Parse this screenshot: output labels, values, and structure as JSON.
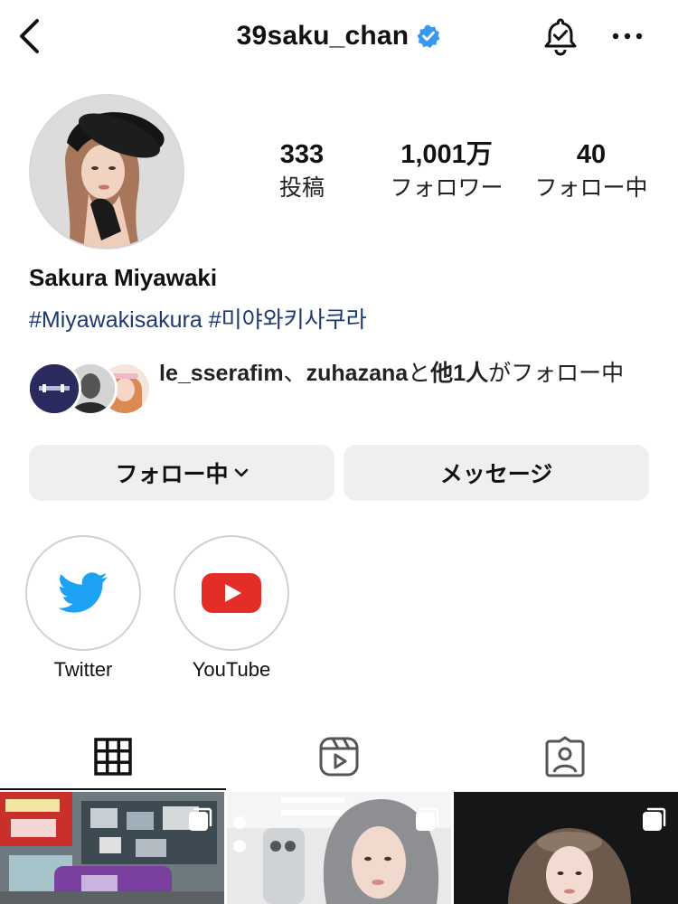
{
  "header": {
    "username": "39saku_chan",
    "back_icon": "chevron-left-icon",
    "verified_icon": "verified-badge-icon",
    "bell_icon": "bell-check-icon",
    "more_icon": "more-horizontal-icon"
  },
  "profile": {
    "display_name": "Sakura Miyawaki",
    "hashtags": [
      "#Miyawakisakura",
      "#미야와키사쿠라"
    ]
  },
  "stats": [
    {
      "value": "333",
      "label": "投稿"
    },
    {
      "value": "1,001万",
      "label": "フォロワー"
    },
    {
      "value": "40",
      "label": "フォロー中"
    }
  ],
  "followed_by": {
    "accounts": [
      "le_sserafim",
      "zuhazana"
    ],
    "separator": "、",
    "suffix_1": "と",
    "others": "他1人",
    "suffix_2": "がフォロー中"
  },
  "actions": {
    "following_label": "フォロー中",
    "message_label": "メッセージ"
  },
  "highlights": [
    {
      "label": "Twitter",
      "icon": "twitter-bird-icon"
    },
    {
      "label": "YouTube",
      "icon": "youtube-play-icon"
    }
  ],
  "tabs": [
    {
      "name": "posts",
      "icon": "grid-icon",
      "active": true
    },
    {
      "name": "reels",
      "icon": "reels-icon",
      "active": false
    },
    {
      "name": "tagged",
      "icon": "tagged-person-icon",
      "active": false
    }
  ],
  "colors": {
    "verified": "#3897f0",
    "hashtag": "#1e3a6e",
    "button_bg": "#efefef",
    "twitter": "#1da1f2",
    "youtube": "#e52d27"
  }
}
